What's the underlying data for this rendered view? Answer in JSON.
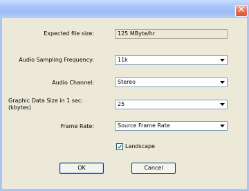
{
  "titlebar": {
    "close_icon": "close-x"
  },
  "fields": [
    {
      "label": "Expected file size:",
      "value": "125 MByte/hr",
      "type": "readonly"
    },
    {
      "label": "Audio Sampling Frequency:",
      "value": "11k",
      "type": "select"
    },
    {
      "label": "Audio Channel:",
      "value": "Stereo",
      "type": "select"
    },
    {
      "label": "Graphic Data Size in 1 sec: (kbytes)",
      "value": "25",
      "type": "select"
    },
    {
      "label": "Frame Rate:",
      "value": "Source Frame Rate",
      "type": "select"
    }
  ],
  "landscape": {
    "label": "Landscape",
    "checked": true
  },
  "buttons": {
    "ok": "OK",
    "cancel": "Cancel"
  }
}
